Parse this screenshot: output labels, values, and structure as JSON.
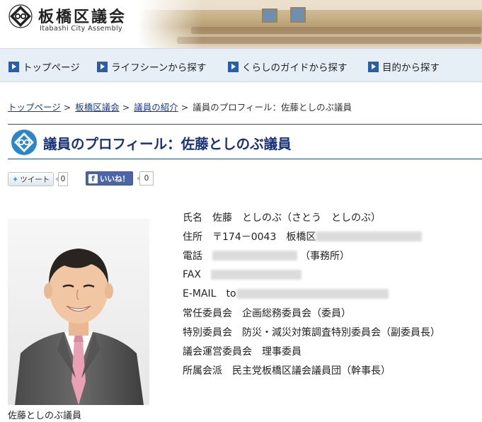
{
  "header": {
    "title": "板橋区議会",
    "subtitle": "Itabashi City Assembly",
    "emblem_icon": "itabashi-emblem-icon"
  },
  "gnav": {
    "items": [
      {
        "label": "トップページ"
      },
      {
        "label": "ライフシーンから探す"
      },
      {
        "label": "くらしのガイドから探す"
      },
      {
        "label": "目的から探す"
      }
    ]
  },
  "breadcrumb": {
    "items": [
      {
        "label": "トップページ"
      },
      {
        "label": "板橋区議会"
      },
      {
        "label": "議員の紹介"
      }
    ],
    "separator": ">",
    "current": "議員のプロフィール：佐藤としのぶ議員"
  },
  "page": {
    "title": "議員のプロフィール：佐藤としのぶ議員"
  },
  "social": {
    "tweet_label": "ツイート",
    "tweet_count": "0",
    "like_label": "いいね！",
    "like_count": "0"
  },
  "photo": {
    "caption": "佐藤としのぶ議員"
  },
  "profile": {
    "name": {
      "label": "氏名",
      "value": "佐藤　としのぶ（さとう　としのぶ）"
    },
    "address": {
      "label": "住所",
      "value": "〒174－0043　板橋区"
    },
    "phone": {
      "label": "電話",
      "value": "（事務所）"
    },
    "fax": {
      "label": "FAX",
      "value": ""
    },
    "email": {
      "label": "E-MAIL",
      "value": "to"
    },
    "standing_committee": {
      "label": "常任委員会",
      "value": "企画総務委員会（委員）"
    },
    "special_committee": {
      "label": "特別委員会",
      "value": "防災・減災対策調査特別委員会（副委員長）"
    },
    "steering_committee": {
      "label": "議会運営委員会",
      "value": "理事委員"
    },
    "faction": {
      "label": "所属会派",
      "value": "民主党板橋区議会議員団（幹事長）"
    }
  },
  "colors": {
    "accent": "#1f4f9e",
    "nav_bg": "#e6eef6",
    "title_text": "#1a3277",
    "link": "#1a3e8a"
  }
}
